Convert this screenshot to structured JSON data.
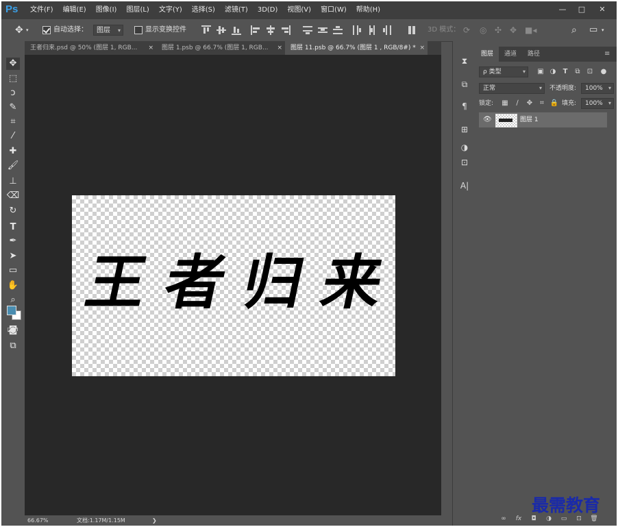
{
  "app": {
    "logo": "Ps"
  },
  "menu": [
    "文件(F)",
    "编辑(E)",
    "图像(I)",
    "图层(L)",
    "文字(Y)",
    "选择(S)",
    "滤镜(T)",
    "3D(D)",
    "视图(V)",
    "窗口(W)",
    "帮助(H)"
  ],
  "window_controls": {
    "minimize": "—",
    "maximize": "□",
    "close": "✕"
  },
  "options": {
    "auto_select_label": "自动选择：",
    "auto_select_checked": true,
    "auto_select_target": "图层",
    "show_transform_label": "显示变换控件",
    "mode_3d_label": "3D 模式："
  },
  "tabs": [
    {
      "label": "王者归来.psd @ 50% (图层 1, RGB...",
      "close": "×"
    },
    {
      "label": "图层 1.psb @ 66.7% (图层 1, RGB...",
      "close": "×"
    },
    {
      "label": "图层 11.psb @ 66.7% (图层 1 , RGB/8#) *",
      "close": "×"
    }
  ],
  "canvas": {
    "text": [
      "王",
      "者",
      "归",
      "来"
    ]
  },
  "status": {
    "zoom": "66.67%",
    "doc": "文档:1.17M/1.15M",
    "arrow": "❯"
  },
  "panel": {
    "tabs": [
      "图层",
      "通道",
      "路径"
    ],
    "filter_label": "ρ 类型",
    "blend_mode": "正常",
    "opacity_label": "不透明度:",
    "opacity_value": "100%",
    "lock_label": "锁定:",
    "fill_label": "填充:",
    "fill_value": "100%",
    "layers": [
      {
        "name": "图层 1",
        "visible": true
      }
    ]
  },
  "footer_icons": [
    "∞",
    "fx",
    "◘",
    "◑",
    "▭",
    "⊡",
    "🗑"
  ],
  "watermark": "最需教育"
}
